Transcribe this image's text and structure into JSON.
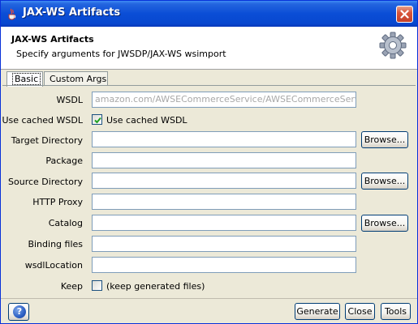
{
  "window": {
    "title": "JAX-WS Artifacts",
    "icon": "java-cup-icon",
    "close_icon": "close-icon",
    "title_color": "#0a4dd6"
  },
  "header": {
    "title": "JAX-WS Artifacts",
    "subtitle": "Specify arguments for JWSDP/JAX-WS wsimport",
    "icon": "gear-icon"
  },
  "tabs": [
    {
      "label": "Basic",
      "active": true
    },
    {
      "label": "Custom Args",
      "active": false
    }
  ],
  "form": {
    "wsdl": {
      "label": "WSDL",
      "value": "amazon.com/AWSECommerceService/AWSECommerceService.wsdl",
      "enabled": false
    },
    "use_cached": {
      "label": "Use cached WSDL",
      "checkbox_label": "Use cached WSDL",
      "checked": true
    },
    "target_directory": {
      "label": "Target Directory",
      "value": "",
      "browse": "Browse..."
    },
    "package": {
      "label": "Package",
      "value": ""
    },
    "source_directory": {
      "label": "Source Directory",
      "value": "",
      "browse": "Browse..."
    },
    "http_proxy": {
      "label": "HTTP Proxy",
      "value": ""
    },
    "catalog": {
      "label": "Catalog",
      "value": "",
      "browse": "Browse..."
    },
    "binding_files": {
      "label": "Binding files",
      "value": ""
    },
    "wsdl_location": {
      "label": "wsdlLocation",
      "value": ""
    },
    "keep": {
      "label": "Keep",
      "checkbox_label": "(keep generated files)",
      "checked": false
    }
  },
  "footer": {
    "help_icon": "help-icon",
    "generate": "Generate",
    "close": "Close",
    "tools": "Tools"
  }
}
